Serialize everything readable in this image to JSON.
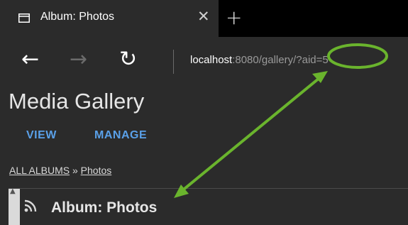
{
  "tab": {
    "title": "Album: Photos",
    "close": "✕",
    "new_tab": "+"
  },
  "nav": {
    "back": "←",
    "forward": "→",
    "refresh": "↻",
    "url_host": "localhost",
    "url_rest": ":8080/gallery/?aid=5"
  },
  "page": {
    "site_title": "Media Gallery",
    "menu": [
      "VIEW",
      "MANAGE"
    ],
    "breadcrumb": {
      "root": "ALL ALBUMS",
      "separator": " » ",
      "current": "Photos"
    },
    "album_title": "Album: Photos"
  },
  "annotation": {
    "color": "#6ab42d"
  }
}
